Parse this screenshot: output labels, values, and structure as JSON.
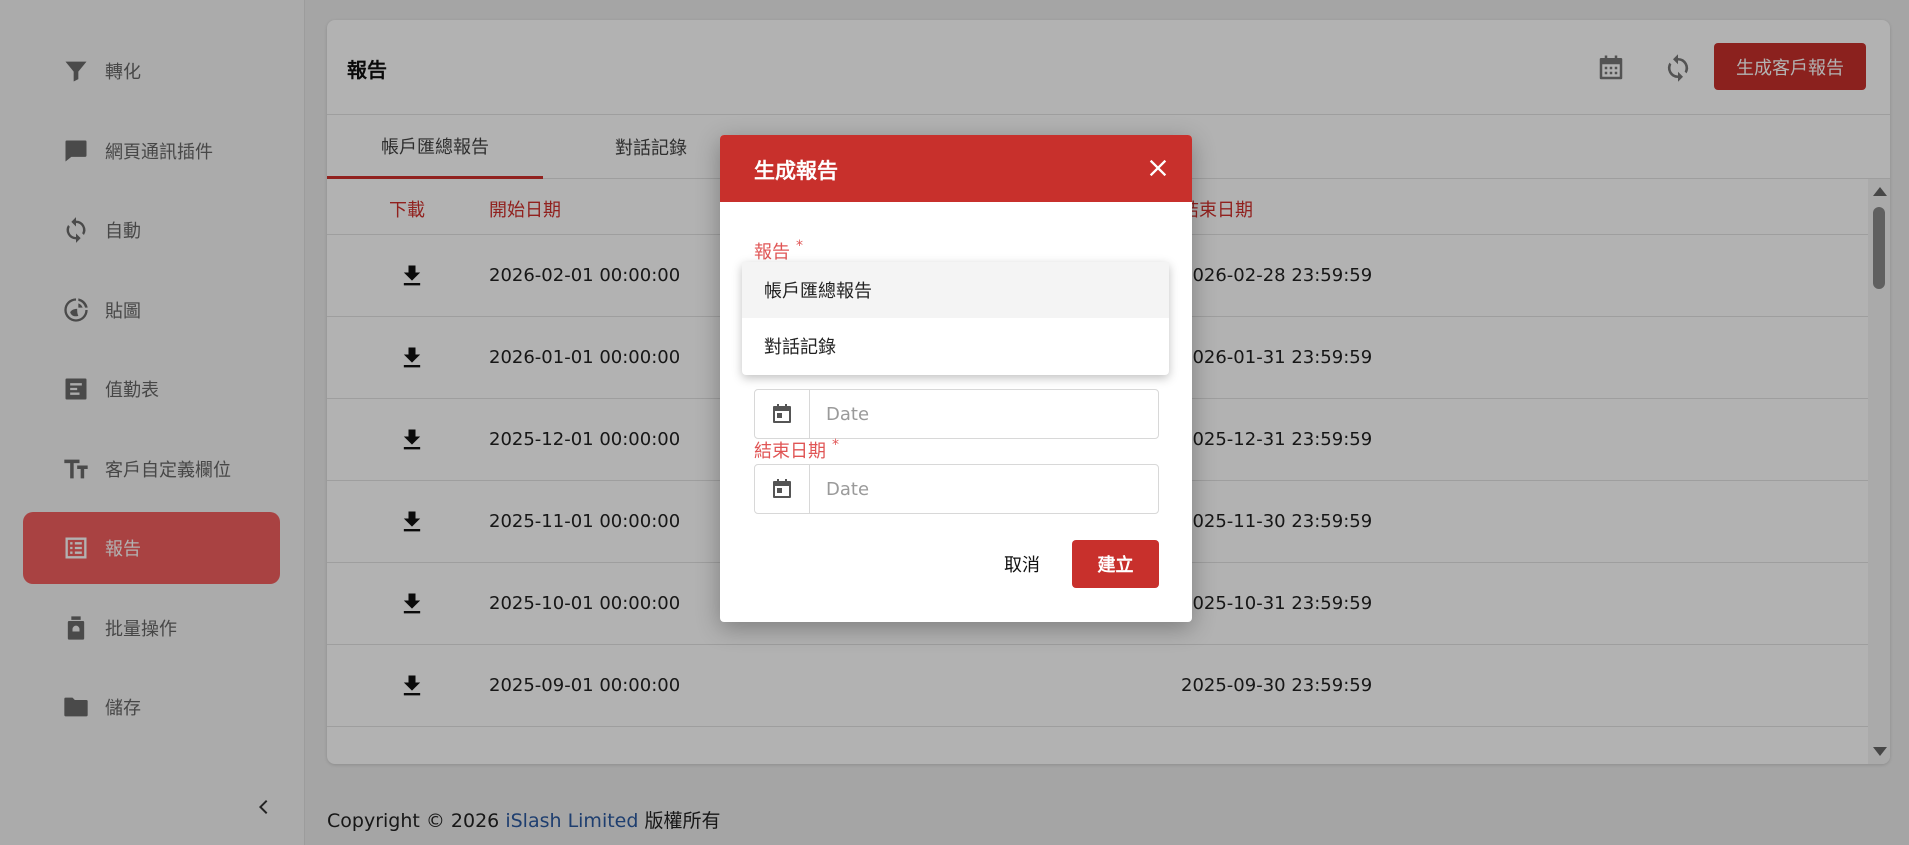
{
  "sidebar": {
    "items": [
      {
        "label": "轉化",
        "icon": "filter-icon",
        "active": false
      },
      {
        "label": "網頁通訊插件",
        "icon": "chat-icon",
        "active": false
      },
      {
        "label": "自動",
        "icon": "sync-icon",
        "active": false
      },
      {
        "label": "貼圖",
        "icon": "sticker-icon",
        "active": false
      },
      {
        "label": "值勤表",
        "icon": "schedule-icon",
        "active": false
      },
      {
        "label": "客戶自定義欄位",
        "icon": "text-fields-icon",
        "active": false
      },
      {
        "label": "報告",
        "icon": "report-icon",
        "active": true
      },
      {
        "label": "批量操作",
        "icon": "batch-icon",
        "active": false
      },
      {
        "label": "儲存",
        "icon": "folder-icon",
        "active": false
      }
    ]
  },
  "header": {
    "title": "報告",
    "generate_label": "生成客戶報告"
  },
  "tabs": [
    {
      "label": "帳戶匯總報告",
      "active": true
    },
    {
      "label": "對話記錄",
      "active": false
    }
  ],
  "table": {
    "columns": {
      "download": "下載",
      "start": "開始日期",
      "end": "結束日期"
    },
    "rows": [
      {
        "start": "2026-02-01 00:00:00",
        "end": "2026-02-28 23:59:59"
      },
      {
        "start": "2026-01-01 00:00:00",
        "end": "2026-01-31 23:59:59"
      },
      {
        "start": "2025-12-01 00:00:00",
        "end": "2025-12-31 23:59:59"
      },
      {
        "start": "2025-11-01 00:00:00",
        "end": "2025-11-30 23:59:59"
      },
      {
        "start": "2025-10-01 00:00:00",
        "end": "2025-10-31 23:59:59"
      },
      {
        "start": "2025-09-01 00:00:00",
        "end": "2025-09-30 23:59:59"
      }
    ]
  },
  "footer": {
    "prefix": "Copyright © 2026",
    "link": "iSlash Limited",
    "suffix": "版權所有"
  },
  "modal": {
    "title": "生成報告",
    "report_label": "報告",
    "required_mark": "*",
    "dropdown_options": [
      "帳戶匯總報告",
      "對話記錄"
    ],
    "start_placeholder": "Date",
    "end_label": "結束日期",
    "end_placeholder": "Date",
    "cancel_label": "取消",
    "create_label": "建立"
  },
  "colors": {
    "brand": "#c8302c",
    "sidebar_active": "#f25f5f",
    "label_red": "#e05555",
    "link": "#2c5aa0"
  }
}
